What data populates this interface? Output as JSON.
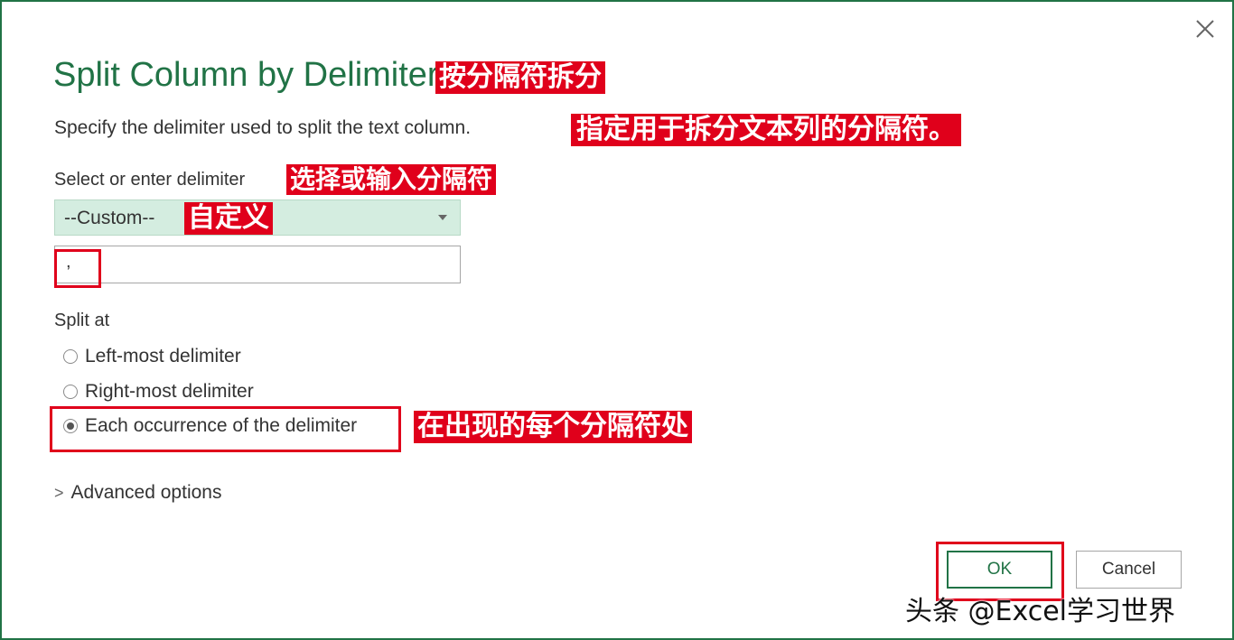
{
  "dialog": {
    "title": "Split Column by Delimiter",
    "description": "Specify the delimiter used to split the text column.",
    "delimiter_label": "Select or enter delimiter",
    "delimiter_select_value": "--Custom--",
    "custom_delimiter_value": ",",
    "split_at_label": "Split at",
    "split_options": [
      {
        "label": "Left-most delimiter",
        "checked": false
      },
      {
        "label": "Right-most delimiter",
        "checked": false
      },
      {
        "label": "Each occurrence of the delimiter",
        "checked": true
      }
    ],
    "advanced_label": "Advanced options",
    "ok_label": "OK",
    "cancel_label": "Cancel"
  },
  "annotations": {
    "title_cn": "按分隔符拆分",
    "description_cn": "指定用于拆分文本列的分隔符。",
    "delimiter_label_cn": "选择或输入分隔符",
    "custom_cn": "自定义",
    "each_occurrence_cn": "在出现的每个分隔符处"
  },
  "watermark": "头条 @Excel学习世界",
  "colors": {
    "accent": "#217346",
    "annotation_red": "#e0001b",
    "select_bg": "#d4ede0"
  },
  "icons": {
    "close": "close-icon",
    "dropdown": "chevron-down-icon",
    "expand": "chevron-right-icon"
  }
}
